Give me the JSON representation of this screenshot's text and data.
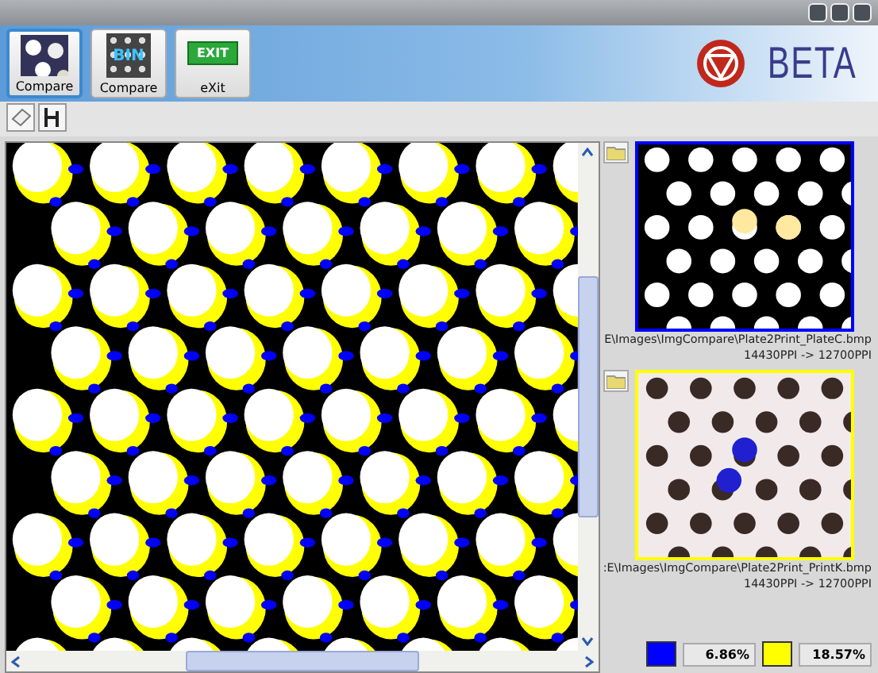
{
  "toolbar": {
    "buttons": [
      {
        "kind": "compare",
        "label": "Compare",
        "selected": true
      },
      {
        "kind": "bin",
        "label": "Compare",
        "icon_text": "BIN",
        "selected": false
      },
      {
        "kind": "exit",
        "label": "eXit",
        "icon_text": "EXIT",
        "selected": false
      }
    ],
    "logo": "BETA"
  },
  "images": [
    {
      "path": "E\\Images\\ImgCompare\\Plate2Print_PlateC.bmp",
      "resolution": "14430PPI -> 12700PPI",
      "color": "#0000ff",
      "kind": "plate"
    },
    {
      "path": ":E\\Images\\ImgCompare\\Plate2Print_PrintK.bmp",
      "resolution": "14430PPI -> 12700PPI",
      "color": "#ffff00",
      "kind": "print"
    }
  ],
  "legend": [
    {
      "color": "#0000ff",
      "value": "6.86%"
    },
    {
      "color": "#ffff00",
      "value": "18.57%"
    }
  ]
}
